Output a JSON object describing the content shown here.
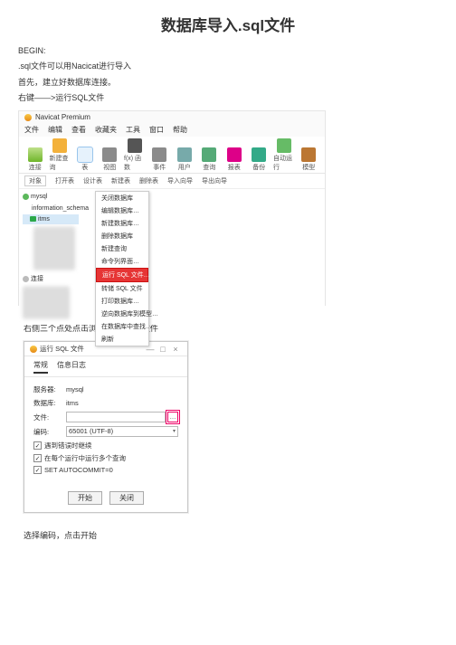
{
  "title": "数据库导入.sql文件",
  "paras": {
    "p1": "BEGIN:",
    "p2": ".sql文件可以用Nacicat进行导入",
    "p3": "首先，建立好数据库连接。",
    "p4": "右键——>运行SQL文件"
  },
  "navicat": {
    "window_title": "Navicat Premium",
    "menubar": [
      "文件",
      "编辑",
      "查看",
      "收藏夹",
      "工具",
      "窗口",
      "帮助"
    ],
    "toolbar": [
      {
        "label": "连接",
        "color": "linear-gradient(#bfe08a,#6fb52a)"
      },
      {
        "label": "新建查询",
        "color": "#f3b13b"
      },
      {
        "label": "表",
        "color": "#4aa0e6",
        "active": true
      },
      {
        "label": "视图",
        "color": "#8b8b8b"
      },
      {
        "label": "f(x) 函数",
        "color": "#555"
      },
      {
        "label": "事件",
        "color": "#8b8b8b"
      },
      {
        "label": "用户",
        "color": "#7aa"
      },
      {
        "label": "查询",
        "color": "#5a7"
      },
      {
        "label": "报表",
        "color": "#d08"
      },
      {
        "label": "备份",
        "color": "#3a8"
      },
      {
        "label": "自动运行",
        "color": "#6b6"
      },
      {
        "label": "模型",
        "color": "#b73"
      }
    ],
    "tabstrip": [
      "对象",
      "打开表",
      "设计表",
      "新建表",
      "删除表",
      "导入向导",
      "导出向导"
    ],
    "tree": {
      "connection": "mysql",
      "dbs": [
        "information_schema",
        "itms"
      ],
      "second_conn": "连接"
    },
    "context_menu": [
      "关闭数据库",
      "编辑数据库…",
      "新建数据库…",
      "删除数据库",
      "新建查询",
      "命令列界面…",
      "运行 SQL 文件…",
      "转储 SQL 文件",
      "打印数据库…",
      "逆向数据库到模型…",
      "在数据库中查找…",
      "刷新"
    ]
  },
  "section2_text": "右侧三个点处点击浏览并选择.sql文件",
  "dialog": {
    "title": "运行 SQL 文件",
    "tabs": [
      "常规",
      "信息日志"
    ],
    "fields": {
      "server_label": "服务器:",
      "server_value": "mysql",
      "db_label": "数据库:",
      "db_value": "itms",
      "file_label": "文件:",
      "file_value": "",
      "encoding_label": "编码:",
      "encoding_value": "65001 (UTF-8)"
    },
    "checks": [
      {
        "checked": true,
        "label": "遇到错误时继续"
      },
      {
        "checked": true,
        "label": "在每个运行中运行多个查询"
      },
      {
        "checked": true,
        "label": "SET AUTOCOMMIT=0"
      }
    ],
    "buttons": {
      "start": "开始",
      "close": "关闭"
    }
  },
  "final_text": "选择编码，点击开始"
}
